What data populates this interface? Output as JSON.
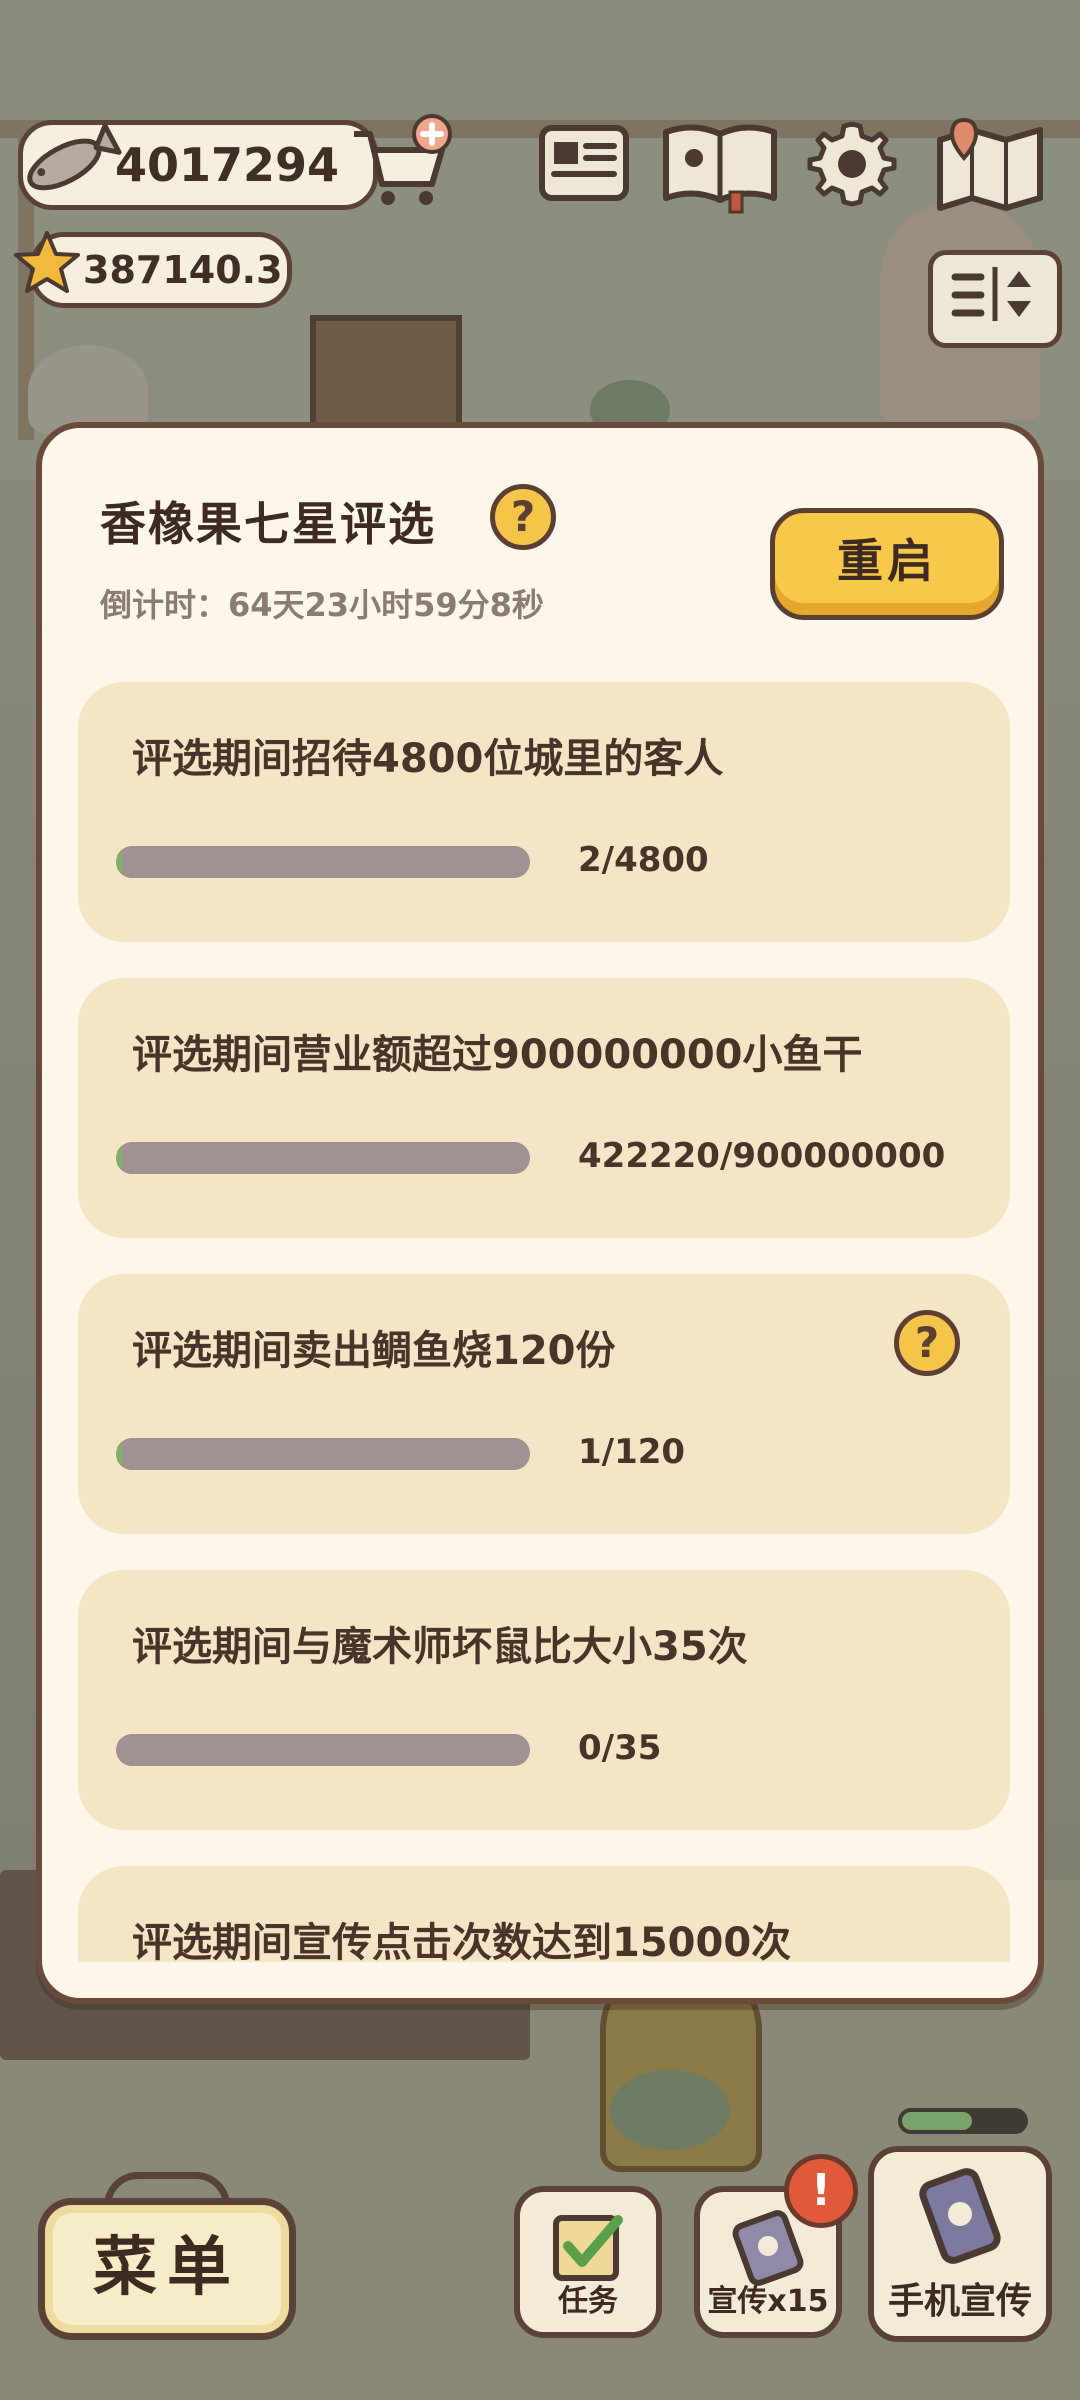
{
  "hud": {
    "fish_currency": "4017294",
    "star_currency": "387140.3",
    "icons": [
      "fish-icon",
      "cart-plus-icon",
      "star-icon",
      "newspaper-icon",
      "album-book-icon",
      "gear-icon",
      "map-icon",
      "sort-toggle-icon"
    ]
  },
  "dialog": {
    "title": "香橡果七星评选",
    "countdown": "倒计时：64天23小时59分8秒",
    "restart_label": "重启",
    "help_symbol": "?",
    "tasks": [
      {
        "label": "评选期间招待4800位城里的客人",
        "progress": "2/4800",
        "fraction": 0.0004,
        "has_help": false
      },
      {
        "label": "评选期间营业额超过900000000小鱼干",
        "progress": "422220/900000000",
        "fraction": 0.0005,
        "has_help": false
      },
      {
        "label": "评选期间卖出鲷鱼烧120份",
        "progress": "1/120",
        "fraction": 0.0083,
        "has_help": true
      },
      {
        "label": "评选期间与魔术师坏鼠比大小35次",
        "progress": "0/35",
        "fraction": 0.0,
        "has_help": false
      },
      {
        "label": "评选期间宣传点击次数达到15000次",
        "progress": "",
        "fraction": 0.0,
        "has_help": false
      }
    ]
  },
  "bottom_bar": {
    "menu_label": "菜单",
    "tasks_label": "任务",
    "promo_label": "宣传x15",
    "phone_promo_label": "手机宣传",
    "alert_symbol": "!"
  },
  "colors": {
    "dialog_bg": "#fdf6ea",
    "card_bg": "#f3e5c5",
    "accent_yellow": "#f7c84a",
    "border_brown": "#5a4336",
    "track_gray": "#a09290",
    "fill_green": "#7fb069",
    "alert_red": "#e05a3a"
  }
}
